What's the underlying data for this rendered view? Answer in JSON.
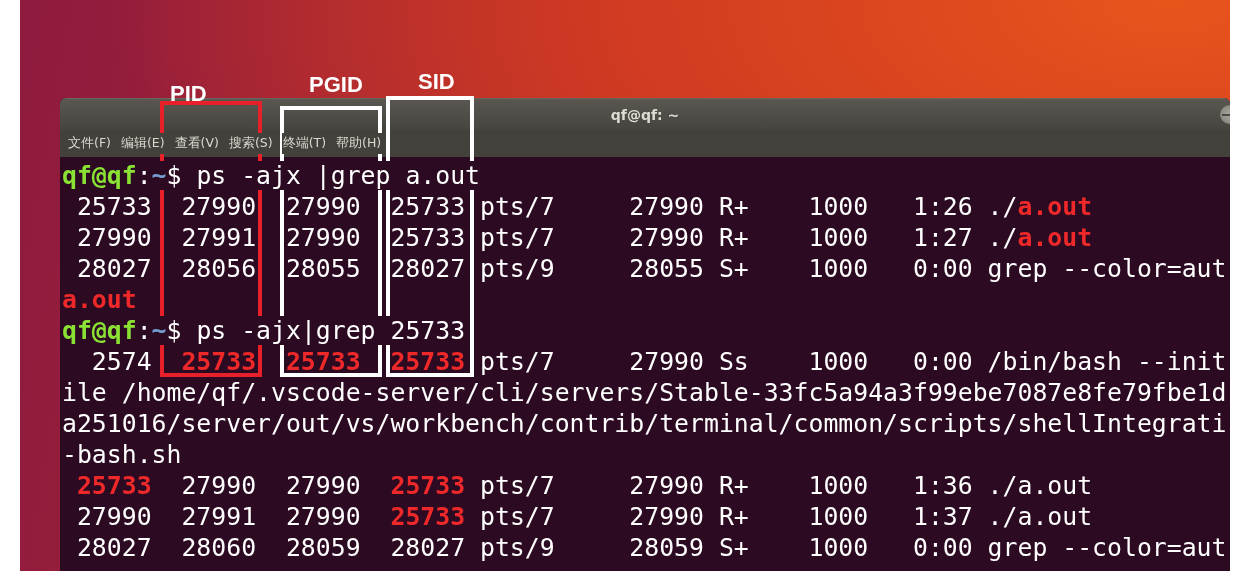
{
  "window": {
    "title": "qf@qf: ~"
  },
  "menu": [
    "文件(F)",
    "编辑(E)",
    "查看(V)",
    "搜索(S)",
    "终端(T)",
    "帮助(H)"
  ],
  "annotations": [
    {
      "label": "PID",
      "color": "#e8202a"
    },
    {
      "label": "PGID",
      "color": "#ffffff"
    },
    {
      "label": "SID",
      "color": "#ffffff"
    }
  ],
  "terminal": {
    "lines": [
      [
        {
          "kind": "user",
          "text": "qf@qf"
        },
        {
          "kind": "sep",
          "text": ":"
        },
        {
          "kind": "path",
          "text": "~"
        },
        {
          "kind": "text",
          "text": "$ ps -ajx |grep a.out"
        }
      ],
      [
        {
          "kind": "text",
          "text": " 25733  27990  27990  25733 pts/7     27990 R+    1000   1:26 ./"
        },
        {
          "kind": "match",
          "text": "a.out"
        }
      ],
      [
        {
          "kind": "text",
          "text": " 27990  27991  27990  25733 pts/7     27990 R+    1000   1:27 ./"
        },
        {
          "kind": "match",
          "text": "a.out"
        }
      ],
      [
        {
          "kind": "text",
          "text": " 28027  28056  28055  28027 pts/9     28055 S+    1000   0:00 grep --color=aut"
        }
      ],
      [
        {
          "kind": "match",
          "text": "a.out"
        }
      ],
      [
        {
          "kind": "user",
          "text": "qf@qf"
        },
        {
          "kind": "sep",
          "text": ":"
        },
        {
          "kind": "path",
          "text": "~"
        },
        {
          "kind": "text",
          "text": "$ ps -ajx|grep 25733"
        }
      ],
      [
        {
          "kind": "text",
          "text": "  2574  "
        },
        {
          "kind": "match",
          "text": "25733  25733  25733"
        },
        {
          "kind": "text",
          "text": " pts/7     27990 Ss    1000   0:00 /bin/bash --init"
        }
      ],
      [
        {
          "kind": "text",
          "text": "ile /home/qf/.vscode-server/cli/servers/Stable-33fc5a94a3f99ebe7087e8fe79fbe1d"
        }
      ],
      [
        {
          "kind": "text",
          "text": "a251016/server/out/vs/workbench/contrib/terminal/common/scripts/shellIntegrati"
        }
      ],
      [
        {
          "kind": "text",
          "text": "-bash.sh"
        }
      ],
      [
        {
          "kind": "match",
          "text": " 25733"
        },
        {
          "kind": "text",
          "text": "  27990  27990  "
        },
        {
          "kind": "match",
          "text": "25733"
        },
        {
          "kind": "text",
          "text": " pts/7     27990 R+    1000   1:36 ./a.out"
        }
      ],
      [
        {
          "kind": "text",
          "text": " 27990  27991  27990  "
        },
        {
          "kind": "match",
          "text": "25733"
        },
        {
          "kind": "text",
          "text": " pts/7     27990 R+    1000   1:37 ./a.out"
        }
      ],
      [
        {
          "kind": "text",
          "text": " 28027  28060  28059  28027 pts/9     28059 S+    1000   0:00 grep --color=aut"
        }
      ]
    ]
  }
}
